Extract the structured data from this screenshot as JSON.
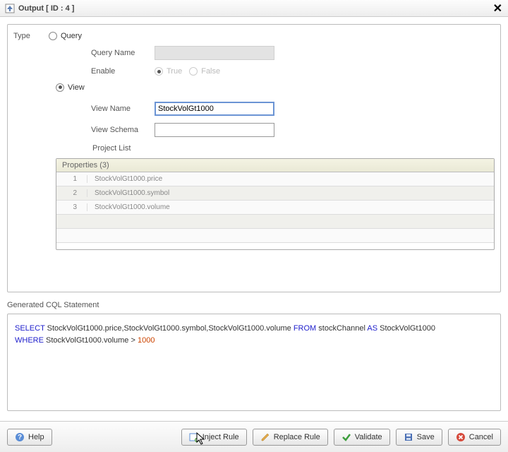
{
  "titlebar": {
    "title": "Output [ ID : 4 ]"
  },
  "panel": {
    "type_label": "Type",
    "query_label": "Query",
    "view_label": "View",
    "query_name_label": "Query Name",
    "enable_label": "Enable",
    "true_label": "True",
    "false_label": "False",
    "view_name_label": "View Name",
    "view_name_value": "StockVolGt1000",
    "view_schema_label": "View Schema",
    "view_schema_value": "",
    "project_list_label": "Project List",
    "table_header": "Properties (3)",
    "rows": [
      {
        "idx": "1",
        "val": "StockVolGt1000.price"
      },
      {
        "idx": "2",
        "val": "StockVolGt1000.symbol"
      },
      {
        "idx": "3",
        "val": "StockVolGt1000.volume"
      }
    ]
  },
  "generated": {
    "label": "Generated CQL Statement",
    "tokens": {
      "select": "SELECT",
      "cols": "StockVolGt1000.price,StockVolGt1000.symbol,StockVolGt1000.volume",
      "from": "FROM",
      "src": "stockChannel",
      "as": "AS",
      "alias": "StockVolGt1000",
      "where": "WHERE",
      "cond_col": "StockVolGt1000.volume",
      "op": ">",
      "val": "1000"
    }
  },
  "footer": {
    "help": "Help",
    "inject": "Inject Rule",
    "replace": "Replace Rule",
    "validate": "Validate",
    "save": "Save",
    "cancel": "Cancel"
  }
}
